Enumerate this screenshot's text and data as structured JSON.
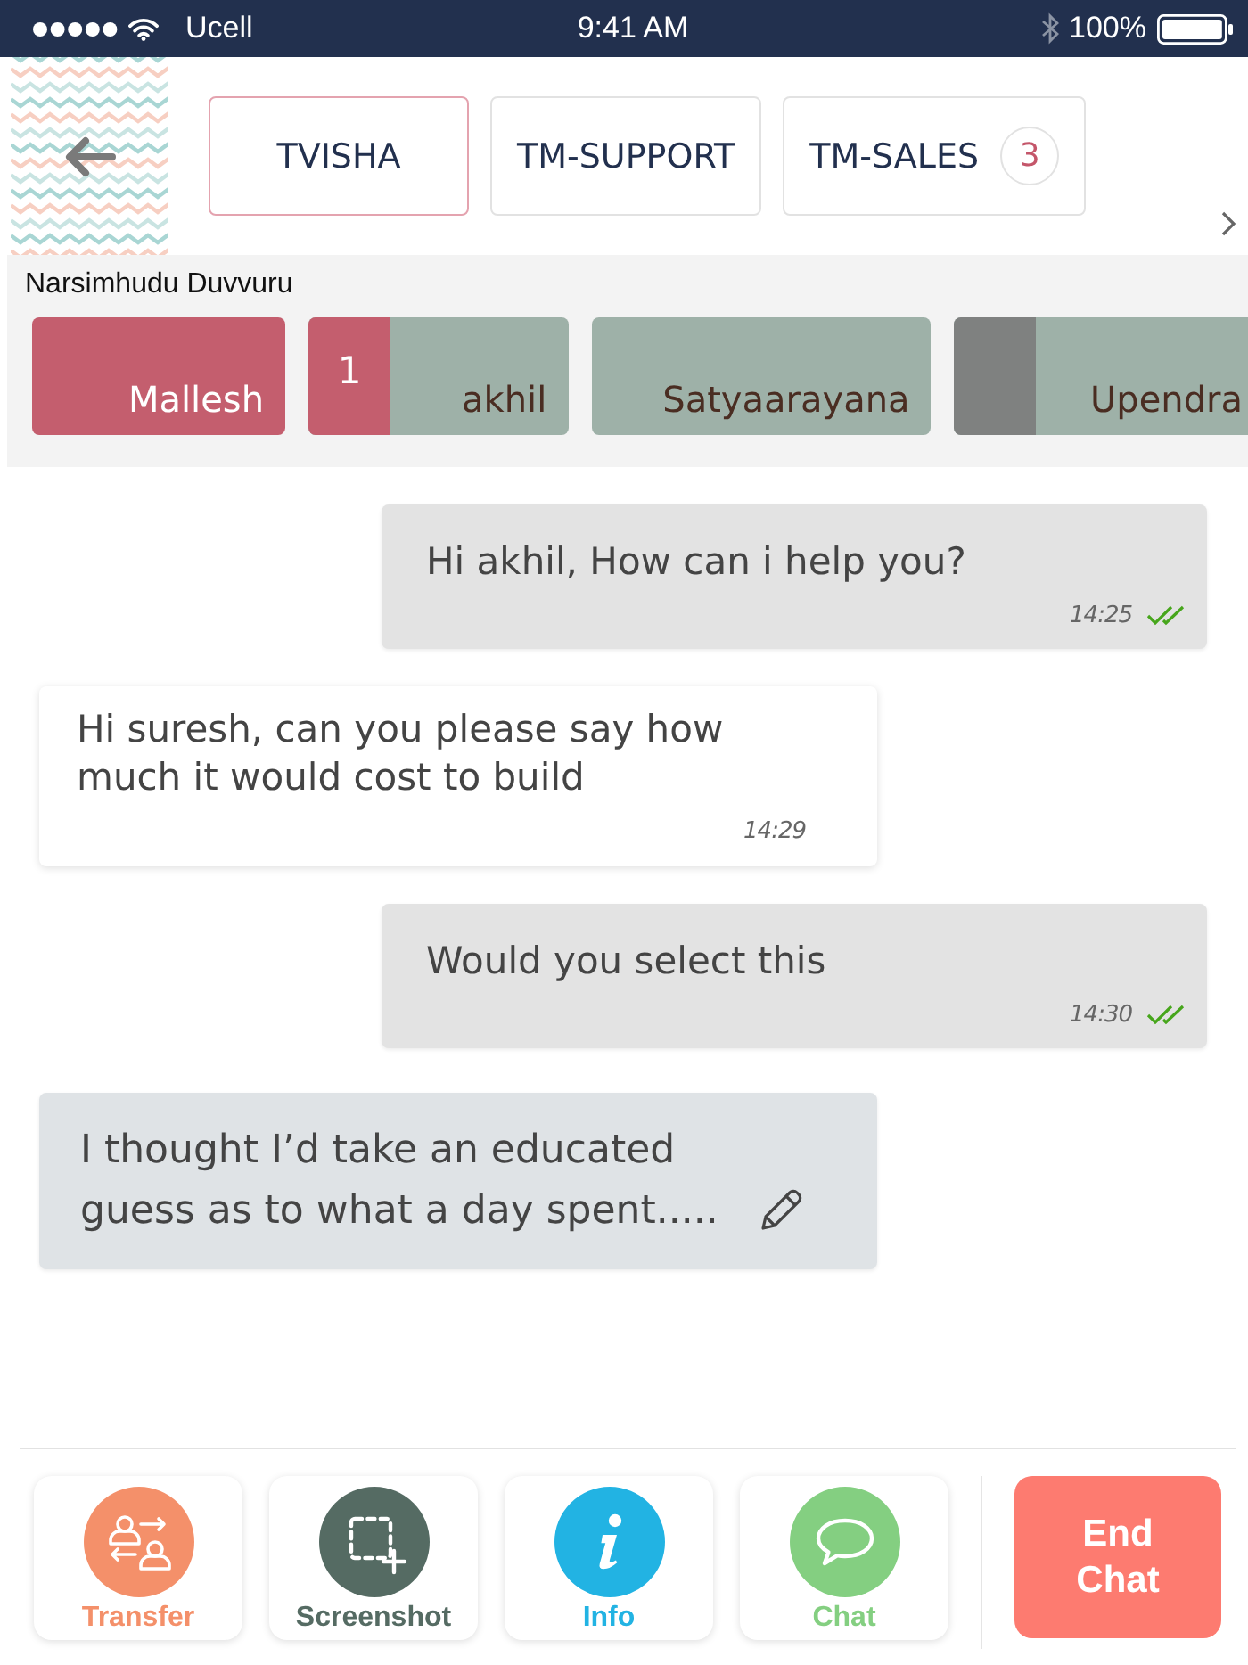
{
  "status_bar": {
    "carrier": "Ucell",
    "time": "9:41 AM",
    "battery": "100%"
  },
  "tabs": [
    {
      "label": "TVISHA",
      "selected": true
    },
    {
      "label": "TM-SUPPORT",
      "selected": false
    },
    {
      "label": "TM-SALES",
      "selected": false,
      "badge": "3"
    }
  ],
  "contacts": {
    "title": "Narsimhudu Duvvuru",
    "items": [
      {
        "name": "Mallesh",
        "kind": "plain",
        "selected": true
      },
      {
        "name": "akhil",
        "kind": "unread",
        "unread": "1",
        "selected": false
      },
      {
        "name": "Satyaarayana",
        "kind": "plain",
        "selected": false
      },
      {
        "name": "Upendra",
        "kind": "idle",
        "selected": false
      }
    ]
  },
  "messages": [
    {
      "kind": "outgoing",
      "text": "Hi akhil, How can i help you?",
      "time": "14:25",
      "read": true
    },
    {
      "kind": "incoming",
      "text": "Hi suresh, can you please say how much it would cost to build",
      "time": "14:29"
    },
    {
      "kind": "outgoing",
      "text": "Would you select this",
      "time": "14:30",
      "read": true
    },
    {
      "kind": "draft",
      "text": "I thought I’d take an educated guess as to what a day spent....."
    }
  ],
  "actions": [
    {
      "kind": "transfer",
      "label": "Transfer",
      "color": "#f4906a"
    },
    {
      "kind": "screenshot",
      "label": "Screenshot",
      "color": "#556b63"
    },
    {
      "kind": "info",
      "label": "Info",
      "color": "#22b3e3"
    },
    {
      "kind": "chat",
      "label": "Chat",
      "color": "#84cf81"
    }
  ],
  "end_button": {
    "label": "End Chat"
  }
}
